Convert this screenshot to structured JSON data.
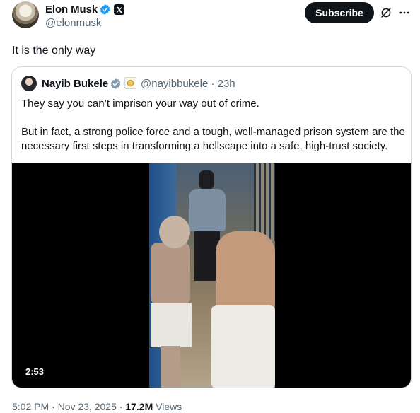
{
  "author": {
    "name": "Elon Musk",
    "handle": "@elonmusk",
    "verified_icon": "verified-badge-icon",
    "affiliate_icon": "x-logo-icon"
  },
  "actions": {
    "subscribe_label": "Subscribe",
    "grok_icon": "grok-icon",
    "more_icon": "more-options-icon"
  },
  "tweet": {
    "text": "It is the only way"
  },
  "quoted": {
    "name": "Nayib Bukele",
    "handle_time": "@nayibbukele · 23h",
    "text1": "They say you can’t imprison your way out of crime.",
    "text2": "But in fact, a strong police force and a tough, well-managed prison system are the necessary first steps in transforming a hellscape into a safe, high-trust society.",
    "video": {
      "duration": "2:53"
    }
  },
  "meta": {
    "time": "5:02 PM",
    "date": "Nov 23, 2025",
    "views_count": "17.2M",
    "views_label": "Views"
  },
  "colors": {
    "verified_blue": "#1d9bf0",
    "text": "#0f1419",
    "secondary": "#536471",
    "border": "#cfd9de"
  }
}
